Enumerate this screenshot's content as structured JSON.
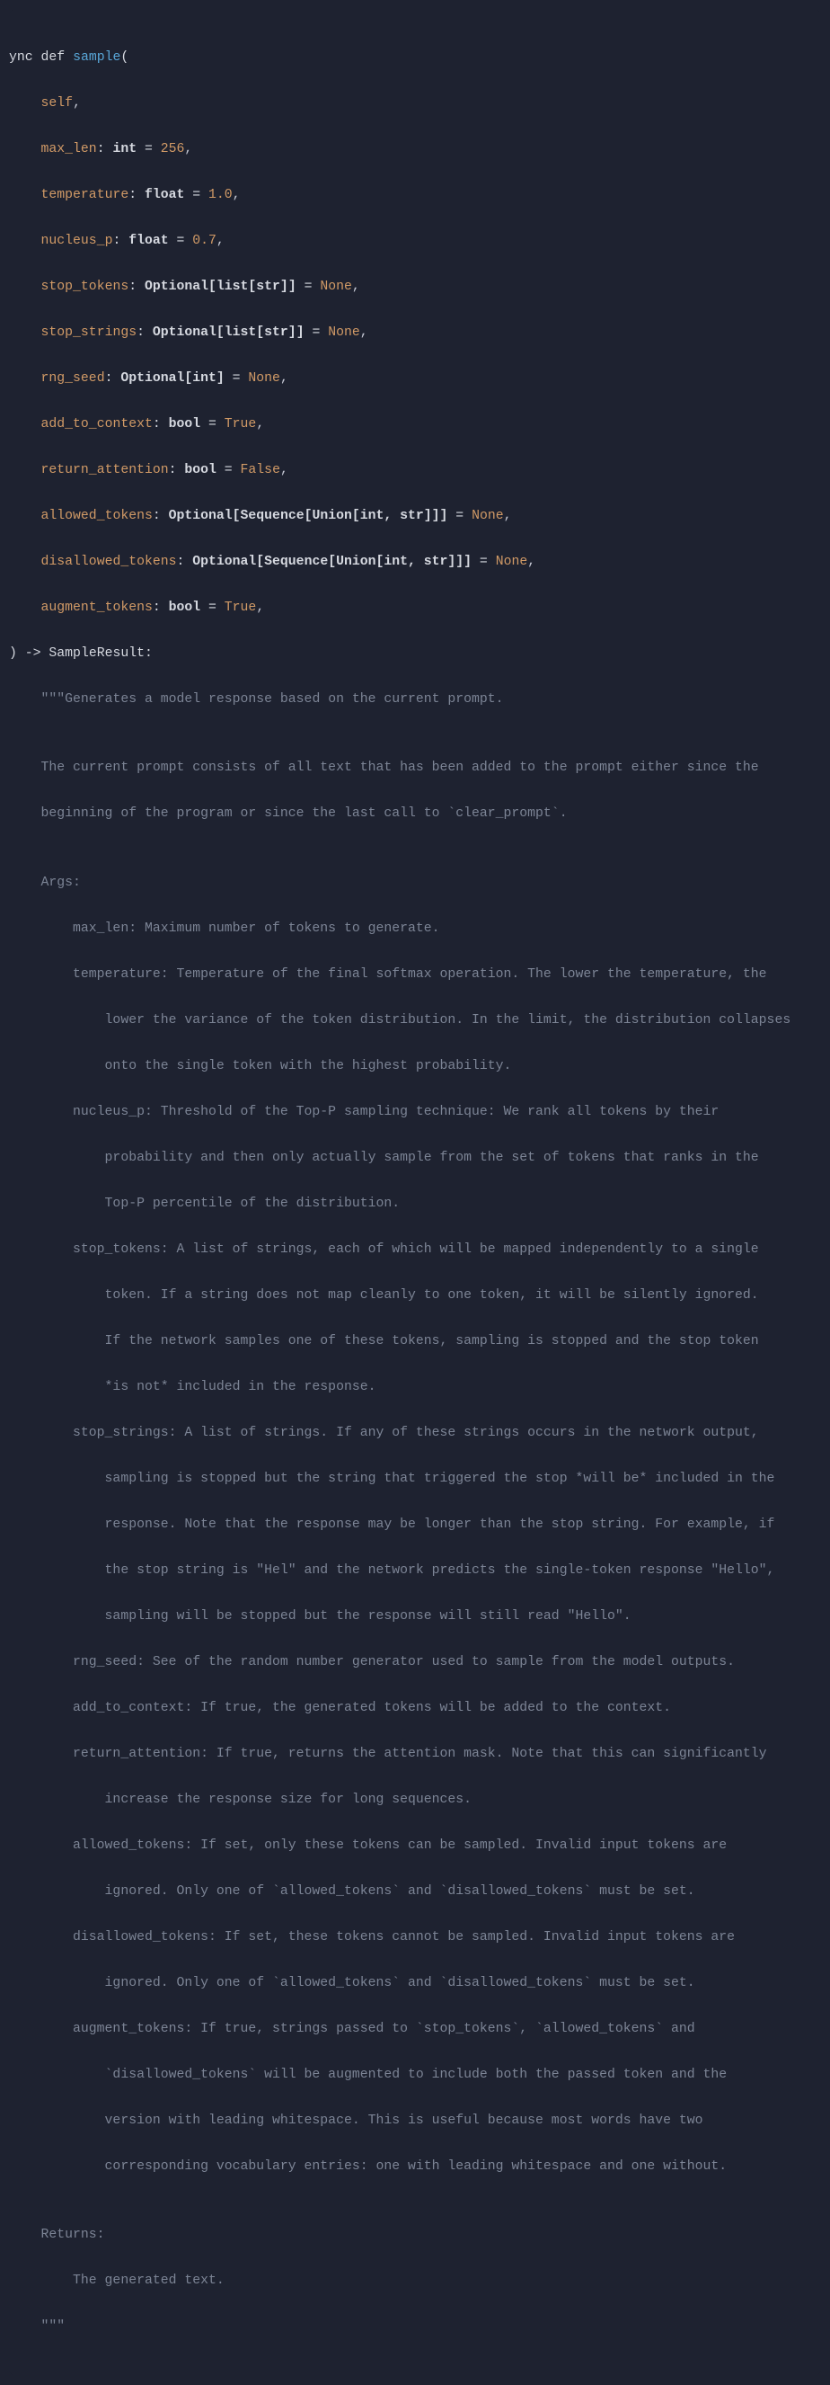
{
  "code": {
    "l1_def": "ync ",
    "l1_def2": "def ",
    "l1_fn": "sample",
    "l1_open": "(",
    "p_self": "self",
    "p_max_len": "max_len",
    "t_int": "int",
    "v_256": "256",
    "p_temperature": "temperature",
    "t_float": "float",
    "v_1_0": "1.0",
    "p_nucleus_p": "nucleus_p",
    "v_0_7": "0.7",
    "p_stop_tokens": "stop_tokens",
    "t_opt_list_str": "Optional[list[str]]",
    "v_none": "None",
    "p_stop_strings": "stop_strings",
    "p_rng_seed": "rng_seed",
    "t_opt_int": "Optional[int]",
    "p_add_to_context": "add_to_context",
    "t_bool": "bool",
    "v_true": "True",
    "p_return_attention": "return_attention",
    "v_false": "False",
    "p_allowed_tokens": "allowed_tokens",
    "t_opt_seq_union": "Optional[Sequence[Union[int, str]]]",
    "p_disallowed_tokens": "disallowed_tokens",
    "p_augment_tokens": "augment_tokens",
    "ret_arrow": " -> ",
    "ret_type": "SampleResult",
    "colon": ":",
    "comma": ",",
    "eq": " = ",
    "colon_sp": ": ",
    "close_paren": ")",
    "indent1": "    ",
    "indent2": "        ",
    "indent3": "            ",
    "doc_open": "    \"\"\"",
    "doc_l1": "Generates a model response based on the current prompt.",
    "doc_blank": "",
    "doc_l2": "    The current prompt consists of all text that has been added to the prompt either since the",
    "doc_l3": "    beginning of the program or since the last call to `clear_prompt`.",
    "doc_args": "    Args:",
    "doc_a1": "        max_len: Maximum number of tokens to generate.",
    "doc_a2_1": "        temperature: Temperature of the final softmax operation. The lower the temperature, the",
    "doc_a2_2": "            lower the variance of the token distribution. In the limit, the distribution collapses",
    "doc_a2_3": "            onto the single token with the highest probability.",
    "doc_a3_1": "        nucleus_p: Threshold of the Top-P sampling technique: We rank all tokens by their",
    "doc_a3_2": "            probability and then only actually sample from the set of tokens that ranks in the",
    "doc_a3_3": "            Top-P percentile of the distribution.",
    "doc_a4_1": "        stop_tokens: A list of strings, each of which will be mapped independently to a single",
    "doc_a4_2": "            token. If a string does not map cleanly to one token, it will be silently ignored.",
    "doc_a4_3": "            If the network samples one of these tokens, sampling is stopped and the stop token",
    "doc_a4_4": "            *is not* included in the response.",
    "doc_a5_1": "        stop_strings: A list of strings. If any of these strings occurs in the network output,",
    "doc_a5_2": "            sampling is stopped but the string that triggered the stop *will be* included in the",
    "doc_a5_3": "            response. Note that the response may be longer than the stop string. For example, if",
    "doc_a5_4": "            the stop string is \"Hel\" and the network predicts the single-token response \"Hello\",",
    "doc_a5_5": "            sampling will be stopped but the response will still read \"Hello\".",
    "doc_a6": "        rng_seed: See of the random number generator used to sample from the model outputs.",
    "doc_a7": "        add_to_context: If true, the generated tokens will be added to the context.",
    "doc_a8_1": "        return_attention: If true, returns the attention mask. Note that this can significantly",
    "doc_a8_2": "            increase the response size for long sequences.",
    "doc_a9_1": "        allowed_tokens: If set, only these tokens can be sampled. Invalid input tokens are",
    "doc_a9_2": "            ignored. Only one of `allowed_tokens` and `disallowed_tokens` must be set.",
    "doc_a10_1": "        disallowed_tokens: If set, these tokens cannot be sampled. Invalid input tokens are",
    "doc_a10_2": "            ignored. Only one of `allowed_tokens` and `disallowed_tokens` must be set.",
    "doc_a11_1": "        augment_tokens: If true, strings passed to `stop_tokens`, `allowed_tokens` and",
    "doc_a11_2": "            `disallowed_tokens` will be augmented to include both the passed token and the",
    "doc_a11_3": "            version with leading whitespace. This is useful because most words have two",
    "doc_a11_4": "            corresponding vocabulary entries: one with leading whitespace and one without.",
    "doc_returns": "    Returns:",
    "doc_ret1": "        The generated text.",
    "doc_close": "    \"\"\""
  }
}
